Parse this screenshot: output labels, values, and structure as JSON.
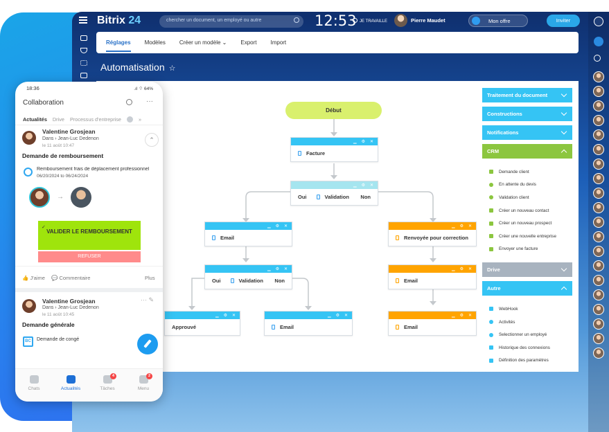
{
  "header": {
    "logo_main": "Bitrix",
    "logo_num": "24",
    "search_placeholder": "chercher un document, un employé ou autre",
    "clock": "12:53",
    "work_status": "JE TRAVAILLE",
    "user_name": "Pierre Maudet",
    "offer": "Mon offre",
    "invite": "Inviter"
  },
  "tabs": [
    "Réglages",
    "Modèles",
    "Créer un modèle",
    "Export",
    "Import"
  ],
  "page_title": "Automatisation",
  "flow": {
    "start": "Début",
    "facture": "Facture",
    "validation1": "Validation",
    "oui1": "Oui",
    "non1": "Non",
    "email1": "Email",
    "renvoyee": "Renvoyée pour correction",
    "validation2": "Validation",
    "oui2": "Oui",
    "non2": "Non",
    "email2": "Email",
    "approuve": "Approuvé",
    "email3": "Email",
    "email4": "Email"
  },
  "panel": {
    "doc": "Traitement du document",
    "constructions": "Constructions",
    "notifications": "Notifications",
    "crm": "CRM",
    "crm_items": [
      "Demande client",
      "En attente du devis",
      "Validation client",
      "Créer un nouveau contact",
      "Créer un nouveau prospect",
      "Créer une nouvelle entreprise",
      "Envoyer une facture"
    ],
    "drive": "Drive",
    "autre": "Autre",
    "autre_items": [
      "WebHook",
      "Activités",
      "Selectionner un employé",
      "Historique des connexions",
      "Définition des paramètres"
    ]
  },
  "mobile": {
    "time": "18:36",
    "battery": "64%",
    "title": "Collaboration",
    "tabs": [
      "Actualités",
      "Drive",
      "Processus d'entreprise"
    ],
    "post1": {
      "name": "Valentine Grosjean",
      "route": "Dans  ›  Jean-Luc Dedenon",
      "date": "le 11 août 10:47",
      "title": "Demande de remboursement",
      "item": "Remboursement frais de déplacement professionnel",
      "dates": "06/20/2024 to 06/24/2024",
      "validate": "VALIDER LE REMBOURSEMENT",
      "refuse": "REFUSER",
      "like": "J'aime",
      "comment": "Commentaire",
      "more": "Plus"
    },
    "post2": {
      "name": "Valentine Grosjean",
      "route": "Dans  ›  Jean-Luc Dedenon",
      "date": "le 11 août 10:45",
      "title": "Demande générale",
      "item": "Demande de congé"
    },
    "nav": [
      "Chats",
      "Actualités",
      "Tâches",
      "Menu"
    ],
    "badges": {
      "taches": "4",
      "menu": "2"
    }
  }
}
